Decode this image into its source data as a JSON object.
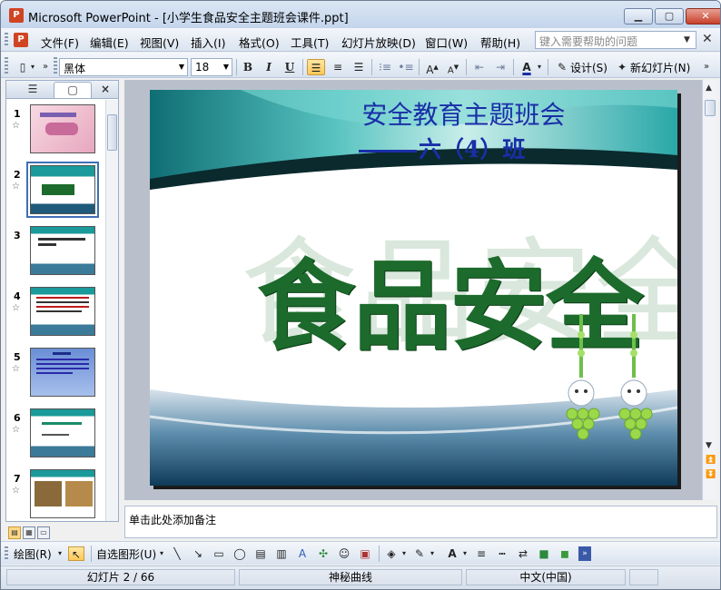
{
  "window": {
    "title": "Microsoft PowerPoint - [小学生食品安全主题班会课件.ppt]",
    "app_icon": "powerpoint-icon"
  },
  "menu": {
    "items": [
      "文件(F)",
      "编辑(E)",
      "视图(V)",
      "插入(I)",
      "格式(O)",
      "工具(T)",
      "幻灯片放映(D)",
      "窗口(W)",
      "帮助(H)"
    ],
    "help_placeholder": "键入需要帮助的问题"
  },
  "format_toolbar": {
    "font": "黑体",
    "size": "18",
    "bold": "B",
    "italic": "I",
    "underline": "U",
    "design_label": "设计(S)",
    "new_slide_label": "新幻灯片(N)"
  },
  "panel": {
    "tabs": [
      "outline-tab",
      "slides-tab"
    ],
    "close": "×",
    "slides": [
      {
        "num": "1",
        "thumb": "pink-cover"
      },
      {
        "num": "2",
        "thumb": "food-safety"
      },
      {
        "num": "3",
        "thumb": "teal-text"
      },
      {
        "num": "4",
        "thumb": "teal-red-text"
      },
      {
        "num": "5",
        "thumb": "blue-text"
      },
      {
        "num": "6",
        "thumb": "teal-green"
      },
      {
        "num": "7",
        "thumb": "photos"
      }
    ],
    "selected_index": 1
  },
  "slide": {
    "title_line1": "安全教育主题班会",
    "title_line2": "六（4）班",
    "main_word": "食品安全",
    "watermark_word": "食品安全",
    "colors": {
      "title": "#1a2ea8",
      "main": "#1c6b2c",
      "header_teal": "#1a8c8c"
    }
  },
  "notes": {
    "placeholder": "单击此处添加备注"
  },
  "draw_toolbar": {
    "draw_label": "绘图(R)",
    "autoshape_label": "自选图形(U)"
  },
  "status": {
    "slide_info": "幻灯片 2 / 66",
    "design_name": "神秘曲线",
    "language": "中文(中国)"
  }
}
